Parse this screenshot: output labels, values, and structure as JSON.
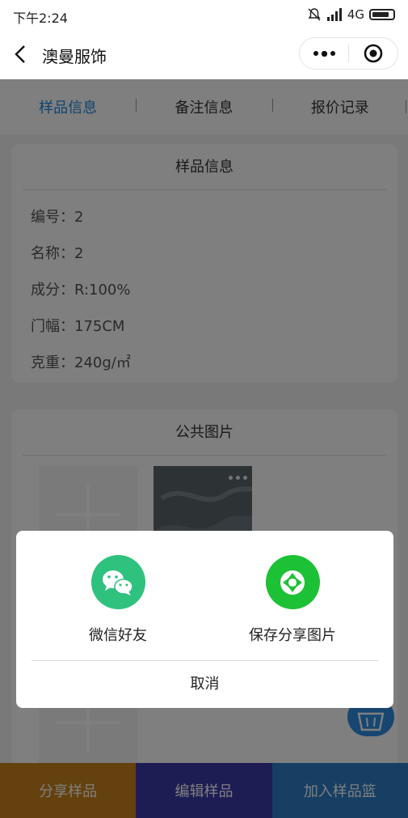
{
  "status_bar": {
    "time": "下午2:24",
    "network": "4G"
  },
  "nav": {
    "title": "澳曼服饰"
  },
  "tabs": [
    {
      "label": "样品信息",
      "active": true
    },
    {
      "label": "备注信息",
      "active": false
    },
    {
      "label": "报价记录",
      "active": false
    }
  ],
  "sample_info": {
    "title": "样品信息",
    "rows": [
      "编号：2",
      "名称：2",
      "成分：R:100%",
      "门幅：175CM",
      "克重：240g/㎡"
    ]
  },
  "public_images": {
    "title": "公共图片"
  },
  "bottom_bar": {
    "buttons": [
      {
        "label": "分享样品",
        "color": "#c9821a"
      },
      {
        "label": "编辑样品",
        "color": "#3a3aa8"
      },
      {
        "label": "加入样品篮",
        "color": "#2d7fc6"
      }
    ]
  },
  "share_sheet": {
    "options": [
      {
        "label": "微信好友",
        "icon": "wechat-icon",
        "color": "#2ec27e"
      },
      {
        "label": "保存分享图片",
        "icon": "moments-icon",
        "color": "#1dc135"
      }
    ],
    "cancel_label": "取消"
  }
}
